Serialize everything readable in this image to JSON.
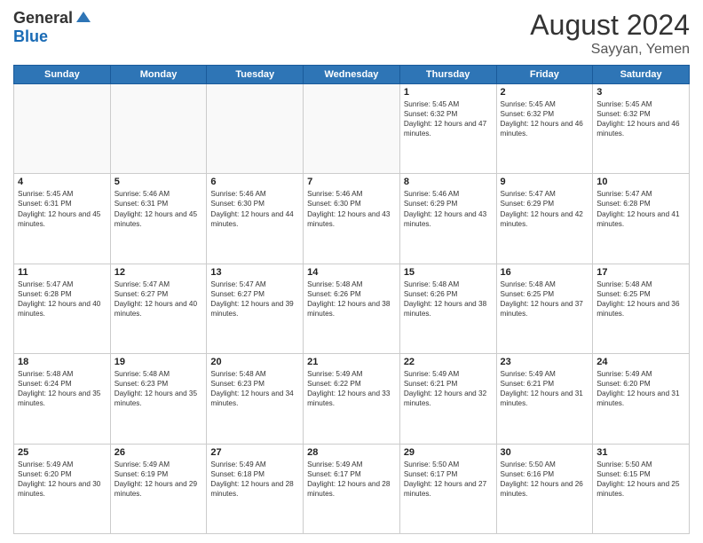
{
  "logo": {
    "general": "General",
    "blue": "Blue"
  },
  "title": {
    "month_year": "August 2024",
    "location": "Sayyan, Yemen"
  },
  "days_of_week": [
    "Sunday",
    "Monday",
    "Tuesday",
    "Wednesday",
    "Thursday",
    "Friday",
    "Saturday"
  ],
  "weeks": [
    [
      {
        "day": "",
        "sunrise": "",
        "sunset": "",
        "daylight": ""
      },
      {
        "day": "",
        "sunrise": "",
        "sunset": "",
        "daylight": ""
      },
      {
        "day": "",
        "sunrise": "",
        "sunset": "",
        "daylight": ""
      },
      {
        "day": "",
        "sunrise": "",
        "sunset": "",
        "daylight": ""
      },
      {
        "day": "1",
        "sunrise": "Sunrise: 5:45 AM",
        "sunset": "Sunset: 6:32 PM",
        "daylight": "Daylight: 12 hours and 47 minutes."
      },
      {
        "day": "2",
        "sunrise": "Sunrise: 5:45 AM",
        "sunset": "Sunset: 6:32 PM",
        "daylight": "Daylight: 12 hours and 46 minutes."
      },
      {
        "day": "3",
        "sunrise": "Sunrise: 5:45 AM",
        "sunset": "Sunset: 6:32 PM",
        "daylight": "Daylight: 12 hours and 46 minutes."
      }
    ],
    [
      {
        "day": "4",
        "sunrise": "Sunrise: 5:45 AM",
        "sunset": "Sunset: 6:31 PM",
        "daylight": "Daylight: 12 hours and 45 minutes."
      },
      {
        "day": "5",
        "sunrise": "Sunrise: 5:46 AM",
        "sunset": "Sunset: 6:31 PM",
        "daylight": "Daylight: 12 hours and 45 minutes."
      },
      {
        "day": "6",
        "sunrise": "Sunrise: 5:46 AM",
        "sunset": "Sunset: 6:30 PM",
        "daylight": "Daylight: 12 hours and 44 minutes."
      },
      {
        "day": "7",
        "sunrise": "Sunrise: 5:46 AM",
        "sunset": "Sunset: 6:30 PM",
        "daylight": "Daylight: 12 hours and 43 minutes."
      },
      {
        "day": "8",
        "sunrise": "Sunrise: 5:46 AM",
        "sunset": "Sunset: 6:29 PM",
        "daylight": "Daylight: 12 hours and 43 minutes."
      },
      {
        "day": "9",
        "sunrise": "Sunrise: 5:47 AM",
        "sunset": "Sunset: 6:29 PM",
        "daylight": "Daylight: 12 hours and 42 minutes."
      },
      {
        "day": "10",
        "sunrise": "Sunrise: 5:47 AM",
        "sunset": "Sunset: 6:28 PM",
        "daylight": "Daylight: 12 hours and 41 minutes."
      }
    ],
    [
      {
        "day": "11",
        "sunrise": "Sunrise: 5:47 AM",
        "sunset": "Sunset: 6:28 PM",
        "daylight": "Daylight: 12 hours and 40 minutes."
      },
      {
        "day": "12",
        "sunrise": "Sunrise: 5:47 AM",
        "sunset": "Sunset: 6:27 PM",
        "daylight": "Daylight: 12 hours and 40 minutes."
      },
      {
        "day": "13",
        "sunrise": "Sunrise: 5:47 AM",
        "sunset": "Sunset: 6:27 PM",
        "daylight": "Daylight: 12 hours and 39 minutes."
      },
      {
        "day": "14",
        "sunrise": "Sunrise: 5:48 AM",
        "sunset": "Sunset: 6:26 PM",
        "daylight": "Daylight: 12 hours and 38 minutes."
      },
      {
        "day": "15",
        "sunrise": "Sunrise: 5:48 AM",
        "sunset": "Sunset: 6:26 PM",
        "daylight": "Daylight: 12 hours and 38 minutes."
      },
      {
        "day": "16",
        "sunrise": "Sunrise: 5:48 AM",
        "sunset": "Sunset: 6:25 PM",
        "daylight": "Daylight: 12 hours and 37 minutes."
      },
      {
        "day": "17",
        "sunrise": "Sunrise: 5:48 AM",
        "sunset": "Sunset: 6:25 PM",
        "daylight": "Daylight: 12 hours and 36 minutes."
      }
    ],
    [
      {
        "day": "18",
        "sunrise": "Sunrise: 5:48 AM",
        "sunset": "Sunset: 6:24 PM",
        "daylight": "Daylight: 12 hours and 35 minutes."
      },
      {
        "day": "19",
        "sunrise": "Sunrise: 5:48 AM",
        "sunset": "Sunset: 6:23 PM",
        "daylight": "Daylight: 12 hours and 35 minutes."
      },
      {
        "day": "20",
        "sunrise": "Sunrise: 5:48 AM",
        "sunset": "Sunset: 6:23 PM",
        "daylight": "Daylight: 12 hours and 34 minutes."
      },
      {
        "day": "21",
        "sunrise": "Sunrise: 5:49 AM",
        "sunset": "Sunset: 6:22 PM",
        "daylight": "Daylight: 12 hours and 33 minutes."
      },
      {
        "day": "22",
        "sunrise": "Sunrise: 5:49 AM",
        "sunset": "Sunset: 6:21 PM",
        "daylight": "Daylight: 12 hours and 32 minutes."
      },
      {
        "day": "23",
        "sunrise": "Sunrise: 5:49 AM",
        "sunset": "Sunset: 6:21 PM",
        "daylight": "Daylight: 12 hours and 31 minutes."
      },
      {
        "day": "24",
        "sunrise": "Sunrise: 5:49 AM",
        "sunset": "Sunset: 6:20 PM",
        "daylight": "Daylight: 12 hours and 31 minutes."
      }
    ],
    [
      {
        "day": "25",
        "sunrise": "Sunrise: 5:49 AM",
        "sunset": "Sunset: 6:20 PM",
        "daylight": "Daylight: 12 hours and 30 minutes."
      },
      {
        "day": "26",
        "sunrise": "Sunrise: 5:49 AM",
        "sunset": "Sunset: 6:19 PM",
        "daylight": "Daylight: 12 hours and 29 minutes."
      },
      {
        "day": "27",
        "sunrise": "Sunrise: 5:49 AM",
        "sunset": "Sunset: 6:18 PM",
        "daylight": "Daylight: 12 hours and 28 minutes."
      },
      {
        "day": "28",
        "sunrise": "Sunrise: 5:49 AM",
        "sunset": "Sunset: 6:17 PM",
        "daylight": "Daylight: 12 hours and 28 minutes."
      },
      {
        "day": "29",
        "sunrise": "Sunrise: 5:50 AM",
        "sunset": "Sunset: 6:17 PM",
        "daylight": "Daylight: 12 hours and 27 minutes."
      },
      {
        "day": "30",
        "sunrise": "Sunrise: 5:50 AM",
        "sunset": "Sunset: 6:16 PM",
        "daylight": "Daylight: 12 hours and 26 minutes."
      },
      {
        "day": "31",
        "sunrise": "Sunrise: 5:50 AM",
        "sunset": "Sunset: 6:15 PM",
        "daylight": "Daylight: 12 hours and 25 minutes."
      }
    ]
  ]
}
